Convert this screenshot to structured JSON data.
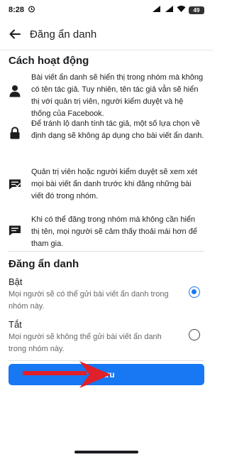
{
  "status_bar": {
    "time": "8:28",
    "battery": "49"
  },
  "header": {
    "title": "Đăng ẩn danh"
  },
  "how_it_works": {
    "title": "Cách hoạt động",
    "items": [
      {
        "icon": "person-icon",
        "text": "Bài viết ẩn danh sẽ hiển thị trong nhóm mà không có tên tác giả. Tuy nhiên, tên tác giả vẫn sẽ hiển thị với quản trị viên, người kiểm duyệt và hệ thống của Facebook."
      },
      {
        "icon": "lock-icon",
        "text": "Để tránh lộ danh tính tác giả, một số lựa chọn về định dạng sẽ không áp dụng cho bài viết ẩn danh."
      },
      {
        "icon": "review-icon",
        "text": "Quản trị viên hoặc người kiểm duyệt sẽ xem xét mọi bài viết ẩn danh trước khi đăng những bài viết đó trong nhóm."
      },
      {
        "icon": "comment-icon",
        "text": "Khi có thể đăng trong nhóm mà không cần hiển thị tên, mọi người sẽ cảm thấy thoải mái hơn để tham gia."
      }
    ]
  },
  "setting": {
    "title": "Đăng ẩn danh",
    "options": [
      {
        "label": "Bật",
        "description": "Mọi người sẽ có thể gửi bài viết ẩn danh trong nhóm này.",
        "selected": true
      },
      {
        "label": "Tắt",
        "description": "Mọi người sẽ không thể gửi bài viết ẩn danh trong nhóm này.",
        "selected": false
      }
    ]
  },
  "save_label": "Lưu",
  "colors": {
    "accent": "#1877f2",
    "arrow": "#e0202a"
  }
}
